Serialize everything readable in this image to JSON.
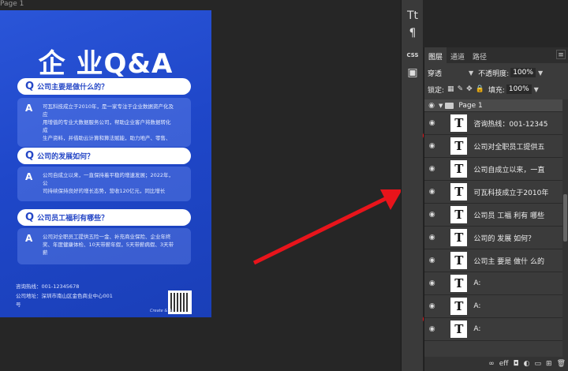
{
  "canvas": {
    "page_label": "Page 1"
  },
  "poster": {
    "title": "企 业Q&A",
    "qa": [
      {
        "q_mark": "Q",
        "question": "公司主要是做什么的？",
        "a_mark": "A",
        "answer_lines": [
          "可瓦科技成立于2010年，是一家专注于企业数据资产化及",
          "应",
          "用增值的专业大数据服务公司，帮助企业客户将数据转化",
          "成",
          "生产资料，并借助云计算和算法赋能，助力地产、零售、"
        ]
      },
      {
        "q_mark": "Q",
        "question": "公司的发展如何？",
        "a_mark": "A",
        "answer_lines": [
          "公司自成立以来，一直保持着平稳的增速发展；2022年，",
          "公",
          "司持续保持良好的增长态势，营收120亿元，同比增长"
        ]
      },
      {
        "q_mark": "Q",
        "question": "公司员工福利有哪些？",
        "a_mark": "A",
        "answer_lines": [
          "公司对全职员工提供五险一金、补充商业保险、企业年终",
          "奖、年度健康体检、10天带薪年假，5天带薪病假、3天带",
          "薪"
        ]
      }
    ],
    "footer": {
      "hotline": "咨询热线：001-12345678",
      "address_line1": "公司地址：深圳市南山区金色商业中心001",
      "address_line2": "号"
    },
    "brand": "Create & Be"
  },
  "toolstrip": {
    "text_tool": "Tt",
    "paragraph_tool": "¶",
    "css_label": "CSS",
    "image_tool": "▣"
  },
  "panel": {
    "tabs": [
      {
        "label": "图层",
        "active": true
      },
      {
        "label": "通道",
        "active": false
      },
      {
        "label": "路径",
        "active": false
      }
    ],
    "blend_mode": "穿透",
    "opacity_label": "不透明度:",
    "opacity_value": "100%",
    "lock_label": "锁定:",
    "fill_label": "填充:",
    "fill_value": "100%",
    "group_name": "Page 1",
    "layers": [
      {
        "thumb": "T",
        "name": "咨询热线：001-12345"
      },
      {
        "thumb": "T",
        "name": "公司对全职员工提供五"
      },
      {
        "thumb": "T",
        "name": "公司自成立以来，一直"
      },
      {
        "thumb": "T",
        "name": "可瓦科技成立于2010年"
      },
      {
        "thumb": "T",
        "name": "公司员 工福 利有 哪些"
      },
      {
        "thumb": "T",
        "name": "公司的 发展 如何？"
      },
      {
        "thumb": "T",
        "name": "公司主 要是 做什 么的"
      },
      {
        "thumb": "T",
        "name": "A:"
      },
      {
        "thumb": "T",
        "name": "A:"
      },
      {
        "thumb": "T",
        "name": "A:"
      }
    ],
    "bottom_icons": [
      "link-icon",
      "effects-icon",
      "mask-icon",
      "adjustment-icon",
      "folder-icon",
      "new-layer-icon",
      "trash-icon"
    ]
  },
  "colors": {
    "poster_blue": "#1f47c9",
    "accent_red": "#e8141b",
    "panel_bg": "#3b3b3b"
  }
}
